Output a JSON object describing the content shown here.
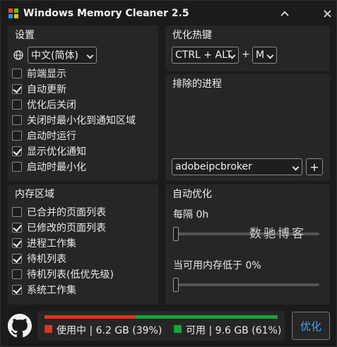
{
  "window": {
    "title": "Windows Memory Cleaner 2.5",
    "controls": {
      "minimize": "⌃",
      "close": "✕"
    }
  },
  "settings": {
    "title": "设置",
    "language": "中文(简体)",
    "options": [
      {
        "label": "前端显示",
        "checked": false
      },
      {
        "label": "自动更新",
        "checked": true
      },
      {
        "label": "优化后关闭",
        "checked": false
      },
      {
        "label": "关闭时最小化到通知区域",
        "checked": false
      },
      {
        "label": "启动时运行",
        "checked": false
      },
      {
        "label": "显示优化通知",
        "checked": true
      },
      {
        "label": "启动时最小化",
        "checked": false
      }
    ]
  },
  "hotkey": {
    "title": "优化热键",
    "modifier": "CTRL + ALT",
    "plus": "+",
    "key": "M"
  },
  "excluded": {
    "title": "排除的进程",
    "selected_process": "adobeipcbroker",
    "add_label": "+"
  },
  "memory_areas": {
    "title": "内存区域",
    "options": [
      {
        "label": "已合并的页面列表",
        "checked": false
      },
      {
        "label": "已修改的页面列表",
        "checked": true
      },
      {
        "label": "进程工作集",
        "checked": true
      },
      {
        "label": "待机列表",
        "checked": true
      },
      {
        "label": "待机列表(低优先级)",
        "checked": false
      },
      {
        "label": "系统工作集",
        "checked": true
      }
    ]
  },
  "auto_optimize": {
    "title": "自动优化",
    "interval_label": "每隔 0h",
    "interval_value": 0,
    "threshold_label": "当可用内存低于 0%",
    "threshold_value": 0
  },
  "memory_status": {
    "used_text": "使用中 | 6.2 GB (39%)",
    "free_text": "可用 | 9.6 GB (61%)",
    "used_fraction": 0.39,
    "used_color": "#d9391f",
    "free_color": "#1aa33a"
  },
  "optimize_label": "优化",
  "watermark": "数驰博客",
  "icons": [
    "app-logo-icon",
    "globe-icon",
    "github-icon",
    "chevron-down-icon"
  ]
}
